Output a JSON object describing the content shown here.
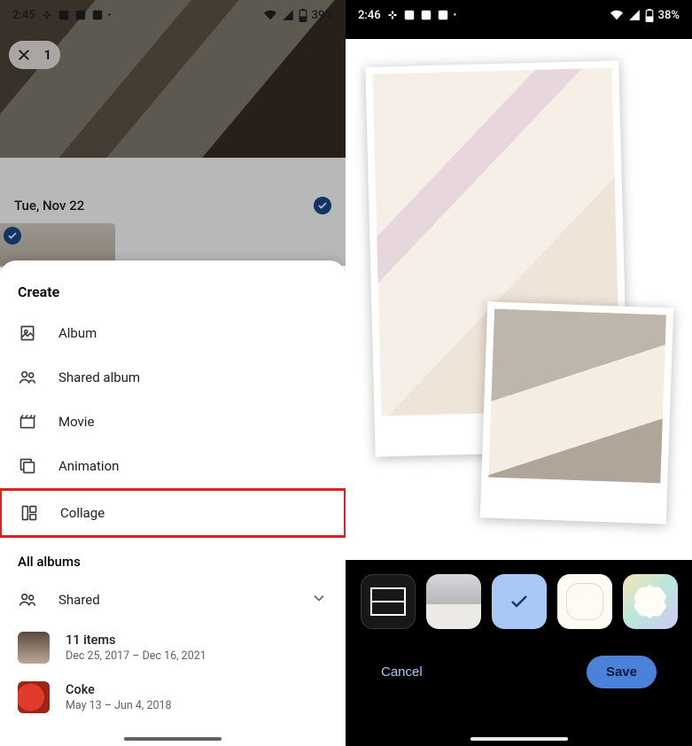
{
  "left": {
    "status": {
      "time": "2:45",
      "battery": "39%"
    },
    "selection_count": "1",
    "date_header": "Tue, Nov 22",
    "sheet": {
      "title": "Create",
      "items": [
        {
          "icon": "album-icon",
          "label": "Album"
        },
        {
          "icon": "shared-album-icon",
          "label": "Shared album"
        },
        {
          "icon": "movie-icon",
          "label": "Movie"
        },
        {
          "icon": "animation-icon",
          "label": "Animation"
        },
        {
          "icon": "collage-icon",
          "label": "Collage"
        }
      ],
      "all_albums_title": "All albums",
      "shared_row": {
        "label": "Shared"
      },
      "album1": {
        "title": "11 items",
        "subtitle": "Dec 25, 2017 – Dec 16, 2021"
      },
      "album2": {
        "title": "Coke",
        "subtitle": "May 13 – Jun 4, 2018"
      }
    }
  },
  "right": {
    "status": {
      "time": "2:46",
      "battery": "38%"
    },
    "actions": {
      "cancel": "Cancel",
      "save": "Save"
    }
  }
}
